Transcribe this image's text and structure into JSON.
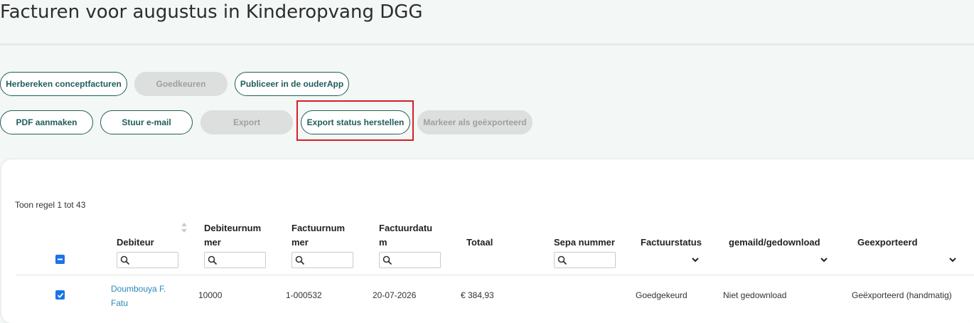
{
  "page_title": "Facturen voor augustus in Kinderopvang DGG",
  "actions": {
    "row1": [
      {
        "label": "Herbereken conceptfacturen",
        "state": "enabled"
      },
      {
        "label": "Goedkeuren",
        "state": "disabled"
      },
      {
        "label": "Publiceer in de ouderApp",
        "state": "enabled"
      }
    ],
    "row2": [
      {
        "label": "PDF aanmaken",
        "state": "enabled"
      },
      {
        "label": "Stuur e-mail",
        "state": "enabled"
      },
      {
        "label": "Export",
        "state": "disabled"
      },
      {
        "label": "Export status herstellen",
        "state": "enabled"
      },
      {
        "label": "Markeer als geëxporteerd",
        "state": "disabled"
      }
    ]
  },
  "table": {
    "info": "Toon regel 1 tot 43",
    "columns": {
      "debiteur": "Debiteur",
      "debiteurnummer_1": "Debiteurnum",
      "debiteurnummer_2": "mer",
      "factuurnummer_1": "Factuurnum",
      "factuurnummer_2": "mer",
      "factuurdatum_1": "Factuurdatu",
      "factuurdatum_2": "m",
      "totaal": "Totaal",
      "sepa": "Sepa nummer",
      "factuurstatus": "Factuurstatus",
      "gemaild": "gemaild/gedownload",
      "geexporteerd": "Geexporteerd"
    },
    "rows": [
      {
        "selected": true,
        "debiteur": "Doumbouya F. Fatu",
        "debiteurnummer": "10000",
        "factuurnummer": "1-000532",
        "factuurdatum": "20-07-2026",
        "totaal": "€ 384,93",
        "sepa": "",
        "factuurstatus": "Goedgekeurd",
        "gemaild": "Niet gedownload",
        "geexporteerd": "Geëxporteerd (handmatig)"
      }
    ]
  },
  "colors": {
    "primary": "#1f5d5b",
    "highlight": "#d42027",
    "link": "#2a8ab8",
    "checkbox": "#1a73e8"
  }
}
